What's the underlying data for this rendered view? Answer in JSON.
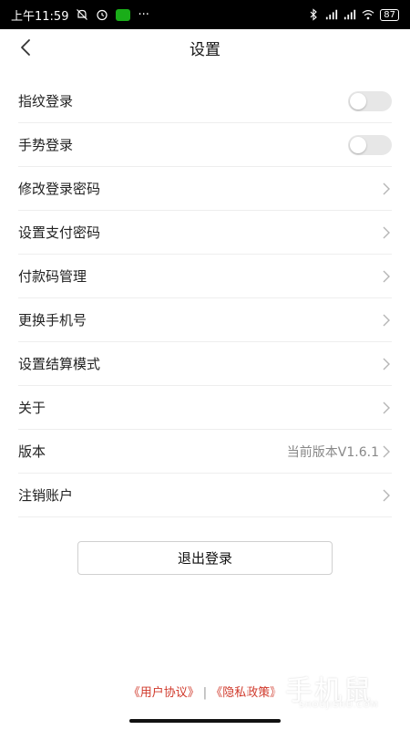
{
  "status_bar": {
    "time": "上午11:59",
    "dots": "···",
    "battery": "87"
  },
  "nav": {
    "title": "设置"
  },
  "settings": [
    {
      "label": "指纹登录",
      "control": "toggle",
      "on": false
    },
    {
      "label": "手势登录",
      "control": "toggle",
      "on": false
    },
    {
      "label": "修改登录密码",
      "control": "chevron"
    },
    {
      "label": "设置支付密码",
      "control": "chevron"
    },
    {
      "label": "付款码管理",
      "control": "chevron"
    },
    {
      "label": "更换手机号",
      "control": "chevron"
    },
    {
      "label": "设置结算模式",
      "control": "chevron"
    },
    {
      "label": "关于",
      "control": "chevron"
    },
    {
      "label": "版本",
      "control": "chevron",
      "value": "当前版本V1.6.1"
    },
    {
      "label": "注销账户",
      "control": "chevron"
    }
  ],
  "logout_label": "退出登录",
  "footer": {
    "user_agreement": "《用户协议》",
    "separator": "|",
    "privacy_policy": "《隐私政策》"
  },
  "watermark": {
    "main": "手机鼠",
    "sub": "SHOUJISHU.COM"
  },
  "colors": {
    "link": "#d0392b",
    "toggle_off": "#e7e7e7",
    "divider": "#eeeeee"
  }
}
